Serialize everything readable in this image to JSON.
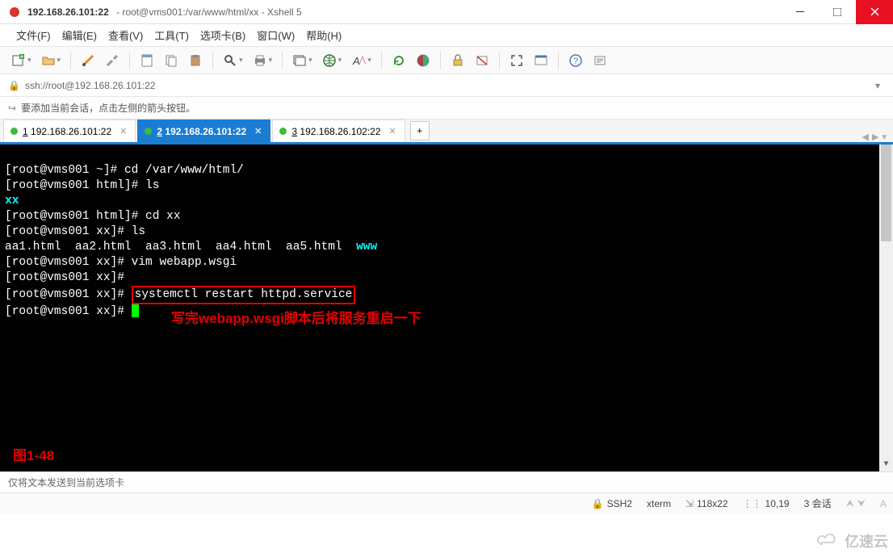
{
  "window": {
    "host": "192.168.26.101:22",
    "path": "root@vms001:/var/www/html/xx",
    "app": "Xshell 5"
  },
  "menu": {
    "file": "文件(F)",
    "edit": "编辑(E)",
    "view": "查看(V)",
    "tools": "工具(T)",
    "tabs": "选项卡(B)",
    "window": "窗口(W)",
    "help": "帮助(H)"
  },
  "address": {
    "url": "ssh://root@192.168.26.101:22"
  },
  "hint": {
    "text": "要添加当前会话，点击左侧的箭头按钮。"
  },
  "tabs": [
    {
      "num": "1",
      "label": "192.168.26.101:22",
      "active": false
    },
    {
      "num": "2",
      "label": "192.168.26.101:22",
      "active": true
    },
    {
      "num": "3",
      "label": "192.168.26.102:22",
      "active": false
    }
  ],
  "term": {
    "l1_prompt": "[root@vms001 ~]# ",
    "l1_cmd": "cd /var/www/html/",
    "l2_prompt": "[root@vms001 html]# ",
    "l2_cmd": "ls",
    "l3_out": "xx",
    "l4_prompt": "[root@vms001 html]# ",
    "l4_cmd": "cd xx",
    "l5_prompt": "[root@vms001 xx]# ",
    "l5_cmd": "ls",
    "l6_out_files": "aa1.html  aa2.html  aa3.html  aa4.html  aa5.html  ",
    "l6_out_dir": "www",
    "l7_prompt": "[root@vms001 xx]# ",
    "l7_cmd": "vim webapp.wsgi",
    "l8_prompt": "[root@vms001 xx]# ",
    "l9_prompt": "[root@vms001 xx]# ",
    "l9_cmd": "systemctl restart httpd.service",
    "l10_prompt": "[root@vms001 xx]# ",
    "annotation": "写完webapp.wsgi脚本后将服务重启一下",
    "fignum": "图1-48"
  },
  "statusline": {
    "text": "仅将文本发送到当前选项卡"
  },
  "footer": {
    "proto": "SSH2",
    "termtype": "xterm",
    "size": "118x22",
    "cursor": "10,19",
    "sessions": "3 会话"
  },
  "watermark": "亿速云"
}
